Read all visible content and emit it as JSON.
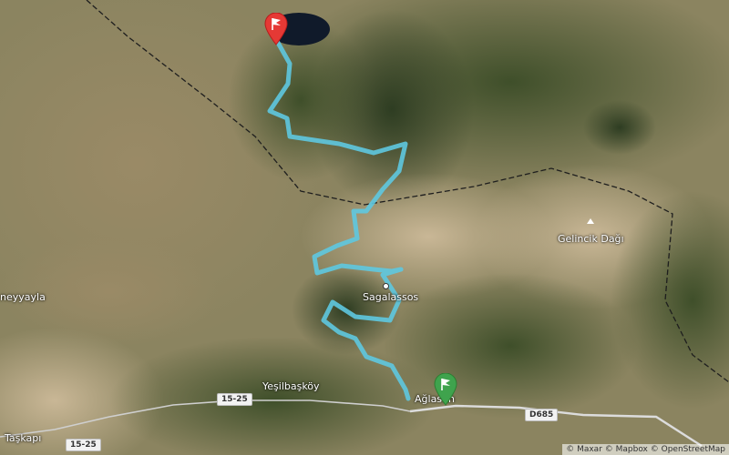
{
  "places": {
    "gelincik": "Gelincik Dağı",
    "sagalassos": "Sagalassos",
    "yesilbaskoy": "Yeşilbaşköy",
    "neyyayla": "neyyayla",
    "taskapi": "Taşkapı",
    "aglasun": "Ağlasun"
  },
  "roads": {
    "d685": "D685",
    "r1525_a": "15-25",
    "r1525_b": "15-25"
  },
  "attribution": "© Maxar © Mapbox © OpenStreetMap",
  "markers": {
    "start": {
      "icon": "green-flag-marker-icon",
      "color": "#3fa34d"
    },
    "end": {
      "icon": "red-flag-marker-icon",
      "color": "#e53935"
    }
  },
  "colors": {
    "route": "#5ec8e0",
    "boundary": "#222222",
    "road": "#e6e6e6"
  }
}
